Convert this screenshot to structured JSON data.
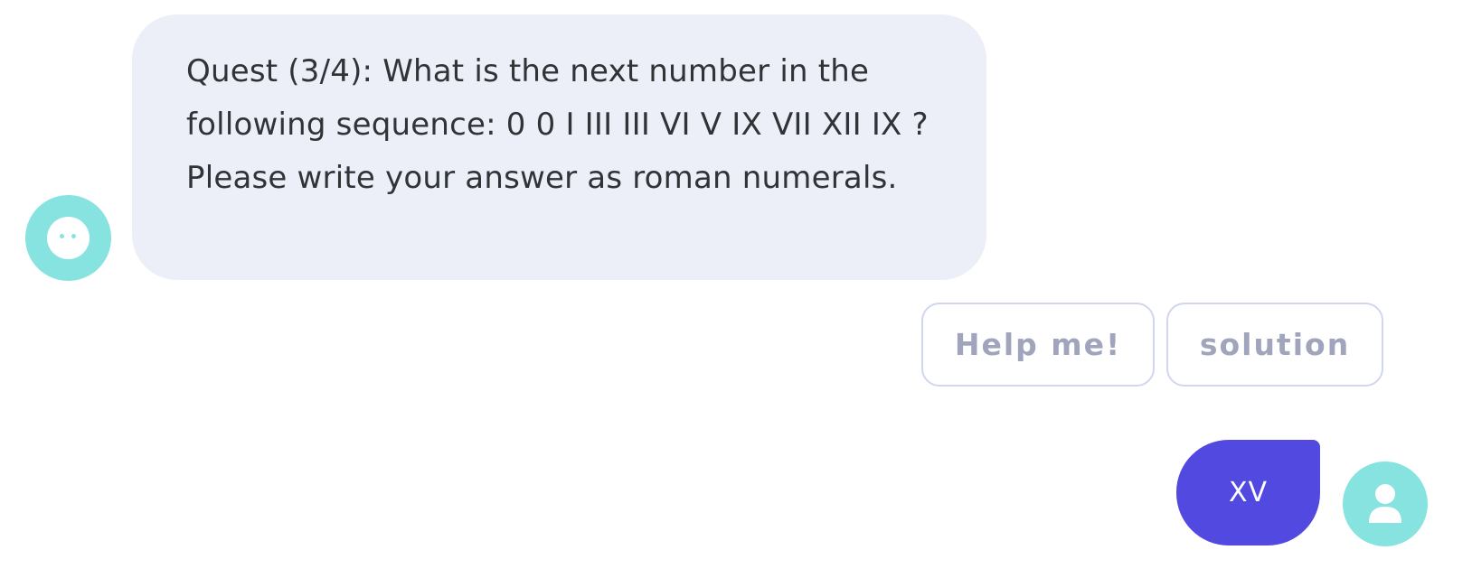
{
  "chat": {
    "bot_message": "Quest (3/4): What is the next number in the following sequence: 0 0 I III III VI V IX VII XII IX ? Please write your answer as roman numerals.",
    "quick_replies": [
      {
        "label": "Help me!"
      },
      {
        "label": "solution"
      }
    ],
    "user_message": "XV"
  },
  "icons": {
    "bot_avatar": "bot-face-icon",
    "user_avatar": "user-icon"
  },
  "colors": {
    "avatar_bg": "#86e3df",
    "bot_bubble_bg": "#eceff8",
    "user_bubble_bg": "#5249e0",
    "quick_reply_border": "#d1d6ee",
    "quick_reply_text": "#a0a5bd"
  }
}
